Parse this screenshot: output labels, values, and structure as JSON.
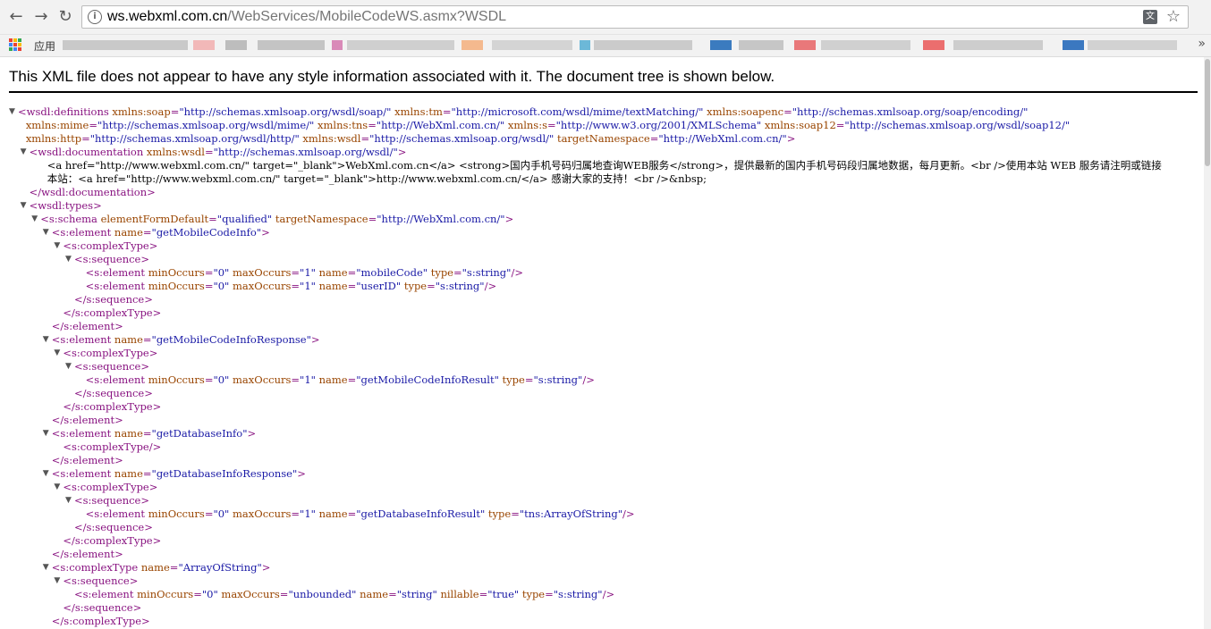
{
  "browser": {
    "url_host": "ws.webxml.com.cn",
    "url_path": "/WebServices/MobileCodeWS.asmx?WSDL",
    "icons": {
      "back": "back-arrow-icon",
      "forward": "forward-arrow-icon",
      "reload": "reload-icon",
      "info": "info-icon",
      "translate": "translate-icon",
      "star": "bookmark-star-icon"
    }
  },
  "bookmarks": {
    "apps_label": "应用",
    "more": "»"
  },
  "notice": "This XML file does not appear to have any style information associated with it. The document tree is shown below.",
  "lines": [
    {
      "d": 0,
      "t": "o",
      "p": [
        {
          "c": "tg",
          "s": "<wsdl:definitions "
        },
        {
          "c": "an",
          "s": "xmlns:soap"
        },
        {
          "c": "tg",
          "s": "="
        },
        {
          "c": "av",
          "s": "\"http://schemas.xmlsoap.org/wsdl/soap/\""
        },
        {
          "c": "an",
          "s": " xmlns:tm"
        },
        {
          "c": "tg",
          "s": "="
        },
        {
          "c": "av",
          "s": "\"http://microsoft.com/wsdl/mime/textMatching/\""
        },
        {
          "c": "an",
          "s": " xmlns:soapenc"
        },
        {
          "c": "tg",
          "s": "="
        },
        {
          "c": "av",
          "s": "\"http://schemas.xmlsoap.org/soap/encoding/\""
        }
      ]
    },
    {
      "d": 0.7,
      "t": "",
      "p": [
        {
          "c": "an",
          "s": "xmlns:mime"
        },
        {
          "c": "tg",
          "s": "="
        },
        {
          "c": "av",
          "s": "\"http://schemas.xmlsoap.org/wsdl/mime/\""
        },
        {
          "c": "an",
          "s": " xmlns:tns"
        },
        {
          "c": "tg",
          "s": "="
        },
        {
          "c": "av",
          "s": "\"http://WebXml.com.cn/\""
        },
        {
          "c": "an",
          "s": " xmlns:s"
        },
        {
          "c": "tg",
          "s": "="
        },
        {
          "c": "av",
          "s": "\"http://www.w3.org/2001/XMLSchema\""
        },
        {
          "c": "an",
          "s": " xmlns:soap12"
        },
        {
          "c": "tg",
          "s": "="
        },
        {
          "c": "av",
          "s": "\"http://schemas.xmlsoap.org/wsdl/soap12/\""
        }
      ]
    },
    {
      "d": 0.7,
      "t": "",
      "p": [
        {
          "c": "an",
          "s": "xmlns:http"
        },
        {
          "c": "tg",
          "s": "="
        },
        {
          "c": "av",
          "s": "\"http://schemas.xmlsoap.org/wsdl/http/\""
        },
        {
          "c": "an",
          "s": " xmlns:wsdl"
        },
        {
          "c": "tg",
          "s": "="
        },
        {
          "c": "av",
          "s": "\"http://schemas.xmlsoap.org/wsdl/\""
        },
        {
          "c": "an",
          "s": " targetNamespace"
        },
        {
          "c": "tg",
          "s": "="
        },
        {
          "c": "av",
          "s": "\"http://WebXml.com.cn/\""
        },
        {
          "c": "tg",
          "s": ">"
        }
      ]
    },
    {
      "d": 1,
      "t": "o",
      "p": [
        {
          "c": "tg",
          "s": "<wsdl:documentation "
        },
        {
          "c": "an",
          "s": "xmlns:wsdl"
        },
        {
          "c": "tg",
          "s": "="
        },
        {
          "c": "av",
          "s": "\"http://schemas.xmlsoap.org/wsdl/\""
        },
        {
          "c": "tg",
          "s": ">"
        }
      ]
    },
    {
      "d": 2.6,
      "t": "",
      "p": [
        {
          "c": "",
          "s": "<a href=\"http://www.webxml.com.cn/\" target=\"_blank\">WebXml.com.cn</a> <strong>国内手机号码归属地查询WEB服务</strong>，提供最新的国内手机号码段归属地数据，每月更新。<br />使用本站 WEB 服务请注明或链接"
        }
      ]
    },
    {
      "d": 2.6,
      "t": "",
      "p": [
        {
          "c": "",
          "s": "本站：<a href=\"http://www.webxml.com.cn/\" target=\"_blank\">http://www.webxml.com.cn/</a> 感谢大家的支持！<br />&nbsp;"
        }
      ]
    },
    {
      "d": 1,
      "t": "",
      "p": [
        {
          "c": "tg",
          "s": "</wsdl:documentation>"
        }
      ]
    },
    {
      "d": 1,
      "t": "o",
      "p": [
        {
          "c": "tg",
          "s": "<wsdl:types>"
        }
      ]
    },
    {
      "d": 2,
      "t": "o",
      "p": [
        {
          "c": "tg",
          "s": "<s:schema "
        },
        {
          "c": "an",
          "s": "elementFormDefault"
        },
        {
          "c": "tg",
          "s": "="
        },
        {
          "c": "av",
          "s": "\"qualified\""
        },
        {
          "c": "an",
          "s": " targetNamespace"
        },
        {
          "c": "tg",
          "s": "="
        },
        {
          "c": "av",
          "s": "\"http://WebXml.com.cn/\""
        },
        {
          "c": "tg",
          "s": ">"
        }
      ]
    },
    {
      "d": 3,
      "t": "o",
      "p": [
        {
          "c": "tg",
          "s": "<s:element "
        },
        {
          "c": "an",
          "s": "name"
        },
        {
          "c": "tg",
          "s": "="
        },
        {
          "c": "av",
          "s": "\"getMobileCodeInfo\""
        },
        {
          "c": "tg",
          "s": ">"
        }
      ]
    },
    {
      "d": 4,
      "t": "o",
      "p": [
        {
          "c": "tg",
          "s": "<s:complexType>"
        }
      ]
    },
    {
      "d": 5,
      "t": "o",
      "p": [
        {
          "c": "tg",
          "s": "<s:sequence>"
        }
      ]
    },
    {
      "d": 6,
      "t": "",
      "p": [
        {
          "c": "tg",
          "s": "<s:element "
        },
        {
          "c": "an",
          "s": "minOccurs"
        },
        {
          "c": "tg",
          "s": "="
        },
        {
          "c": "av",
          "s": "\"0\""
        },
        {
          "c": "an",
          "s": " maxOccurs"
        },
        {
          "c": "tg",
          "s": "="
        },
        {
          "c": "av",
          "s": "\"1\""
        },
        {
          "c": "an",
          "s": " name"
        },
        {
          "c": "tg",
          "s": "="
        },
        {
          "c": "av",
          "s": "\"mobileCode\""
        },
        {
          "c": "an",
          "s": " type"
        },
        {
          "c": "tg",
          "s": "="
        },
        {
          "c": "av",
          "s": "\"s:string\""
        },
        {
          "c": "tg",
          "s": "/>"
        }
      ]
    },
    {
      "d": 6,
      "t": "",
      "p": [
        {
          "c": "tg",
          "s": "<s:element "
        },
        {
          "c": "an",
          "s": "minOccurs"
        },
        {
          "c": "tg",
          "s": "="
        },
        {
          "c": "av",
          "s": "\"0\""
        },
        {
          "c": "an",
          "s": " maxOccurs"
        },
        {
          "c": "tg",
          "s": "="
        },
        {
          "c": "av",
          "s": "\"1\""
        },
        {
          "c": "an",
          "s": " name"
        },
        {
          "c": "tg",
          "s": "="
        },
        {
          "c": "av",
          "s": "\"userID\""
        },
        {
          "c": "an",
          "s": " type"
        },
        {
          "c": "tg",
          "s": "="
        },
        {
          "c": "av",
          "s": "\"s:string\""
        },
        {
          "c": "tg",
          "s": "/>"
        }
      ]
    },
    {
      "d": 5,
      "t": "",
      "p": [
        {
          "c": "tg",
          "s": "</s:sequence>"
        }
      ]
    },
    {
      "d": 4,
      "t": "",
      "p": [
        {
          "c": "tg",
          "s": "</s:complexType>"
        }
      ]
    },
    {
      "d": 3,
      "t": "",
      "p": [
        {
          "c": "tg",
          "s": "</s:element>"
        }
      ]
    },
    {
      "d": 3,
      "t": "o",
      "p": [
        {
          "c": "tg",
          "s": "<s:element "
        },
        {
          "c": "an",
          "s": "name"
        },
        {
          "c": "tg",
          "s": "="
        },
        {
          "c": "av",
          "s": "\"getMobileCodeInfoResponse\""
        },
        {
          "c": "tg",
          "s": ">"
        }
      ]
    },
    {
      "d": 4,
      "t": "o",
      "p": [
        {
          "c": "tg",
          "s": "<s:complexType>"
        }
      ]
    },
    {
      "d": 5,
      "t": "o",
      "p": [
        {
          "c": "tg",
          "s": "<s:sequence>"
        }
      ]
    },
    {
      "d": 6,
      "t": "",
      "p": [
        {
          "c": "tg",
          "s": "<s:element "
        },
        {
          "c": "an",
          "s": "minOccurs"
        },
        {
          "c": "tg",
          "s": "="
        },
        {
          "c": "av",
          "s": "\"0\""
        },
        {
          "c": "an",
          "s": " maxOccurs"
        },
        {
          "c": "tg",
          "s": "="
        },
        {
          "c": "av",
          "s": "\"1\""
        },
        {
          "c": "an",
          "s": " name"
        },
        {
          "c": "tg",
          "s": "="
        },
        {
          "c": "av",
          "s": "\"getMobileCodeInfoResult\""
        },
        {
          "c": "an",
          "s": " type"
        },
        {
          "c": "tg",
          "s": "="
        },
        {
          "c": "av",
          "s": "\"s:string\""
        },
        {
          "c": "tg",
          "s": "/>"
        }
      ]
    },
    {
      "d": 5,
      "t": "",
      "p": [
        {
          "c": "tg",
          "s": "</s:sequence>"
        }
      ]
    },
    {
      "d": 4,
      "t": "",
      "p": [
        {
          "c": "tg",
          "s": "</s:complexType>"
        }
      ]
    },
    {
      "d": 3,
      "t": "",
      "p": [
        {
          "c": "tg",
          "s": "</s:element>"
        }
      ]
    },
    {
      "d": 3,
      "t": "o",
      "p": [
        {
          "c": "tg",
          "s": "<s:element "
        },
        {
          "c": "an",
          "s": "name"
        },
        {
          "c": "tg",
          "s": "="
        },
        {
          "c": "av",
          "s": "\"getDatabaseInfo\""
        },
        {
          "c": "tg",
          "s": ">"
        }
      ]
    },
    {
      "d": 4,
      "t": "",
      "p": [
        {
          "c": "tg",
          "s": "<s:complexType/>"
        }
      ]
    },
    {
      "d": 3,
      "t": "",
      "p": [
        {
          "c": "tg",
          "s": "</s:element>"
        }
      ]
    },
    {
      "d": 3,
      "t": "o",
      "p": [
        {
          "c": "tg",
          "s": "<s:element "
        },
        {
          "c": "an",
          "s": "name"
        },
        {
          "c": "tg",
          "s": "="
        },
        {
          "c": "av",
          "s": "\"getDatabaseInfoResponse\""
        },
        {
          "c": "tg",
          "s": ">"
        }
      ]
    },
    {
      "d": 4,
      "t": "o",
      "p": [
        {
          "c": "tg",
          "s": "<s:complexType>"
        }
      ]
    },
    {
      "d": 5,
      "t": "o",
      "p": [
        {
          "c": "tg",
          "s": "<s:sequence>"
        }
      ]
    },
    {
      "d": 6,
      "t": "",
      "p": [
        {
          "c": "tg",
          "s": "<s:element "
        },
        {
          "c": "an",
          "s": "minOccurs"
        },
        {
          "c": "tg",
          "s": "="
        },
        {
          "c": "av",
          "s": "\"0\""
        },
        {
          "c": "an",
          "s": " maxOccurs"
        },
        {
          "c": "tg",
          "s": "="
        },
        {
          "c": "av",
          "s": "\"1\""
        },
        {
          "c": "an",
          "s": " name"
        },
        {
          "c": "tg",
          "s": "="
        },
        {
          "c": "av",
          "s": "\"getDatabaseInfoResult\""
        },
        {
          "c": "an",
          "s": " type"
        },
        {
          "c": "tg",
          "s": "="
        },
        {
          "c": "av",
          "s": "\"tns:ArrayOfString\""
        },
        {
          "c": "tg",
          "s": "/>"
        }
      ]
    },
    {
      "d": 5,
      "t": "",
      "p": [
        {
          "c": "tg",
          "s": "</s:sequence>"
        }
      ]
    },
    {
      "d": 4,
      "t": "",
      "p": [
        {
          "c": "tg",
          "s": "</s:complexType>"
        }
      ]
    },
    {
      "d": 3,
      "t": "",
      "p": [
        {
          "c": "tg",
          "s": "</s:element>"
        }
      ]
    },
    {
      "d": 3,
      "t": "o",
      "p": [
        {
          "c": "tg",
          "s": "<s:complexType "
        },
        {
          "c": "an",
          "s": "name"
        },
        {
          "c": "tg",
          "s": "="
        },
        {
          "c": "av",
          "s": "\"ArrayOfString\""
        },
        {
          "c": "tg",
          "s": ">"
        }
      ]
    },
    {
      "d": 4,
      "t": "o",
      "p": [
        {
          "c": "tg",
          "s": "<s:sequence>"
        }
      ]
    },
    {
      "d": 5,
      "t": "",
      "p": [
        {
          "c": "tg",
          "s": "<s:element "
        },
        {
          "c": "an",
          "s": "minOccurs"
        },
        {
          "c": "tg",
          "s": "="
        },
        {
          "c": "av",
          "s": "\"0\""
        },
        {
          "c": "an",
          "s": " maxOccurs"
        },
        {
          "c": "tg",
          "s": "="
        },
        {
          "c": "av",
          "s": "\"unbounded\""
        },
        {
          "c": "an",
          "s": " name"
        },
        {
          "c": "tg",
          "s": "="
        },
        {
          "c": "av",
          "s": "\"string\""
        },
        {
          "c": "an",
          "s": " nillable"
        },
        {
          "c": "tg",
          "s": "="
        },
        {
          "c": "av",
          "s": "\"true\""
        },
        {
          "c": "an",
          "s": " type"
        },
        {
          "c": "tg",
          "s": "="
        },
        {
          "c": "av",
          "s": "\"s:string\""
        },
        {
          "c": "tg",
          "s": "/>"
        }
      ]
    },
    {
      "d": 4,
      "t": "",
      "p": [
        {
          "c": "tg",
          "s": "</s:sequence>"
        }
      ]
    },
    {
      "d": 3,
      "t": "",
      "p": [
        {
          "c": "tg",
          "s": "</s:complexType>"
        }
      ]
    }
  ],
  "colors": {
    "tag": "#881280",
    "attr_name": "#994500",
    "attr_value": "#1a1aa6"
  }
}
